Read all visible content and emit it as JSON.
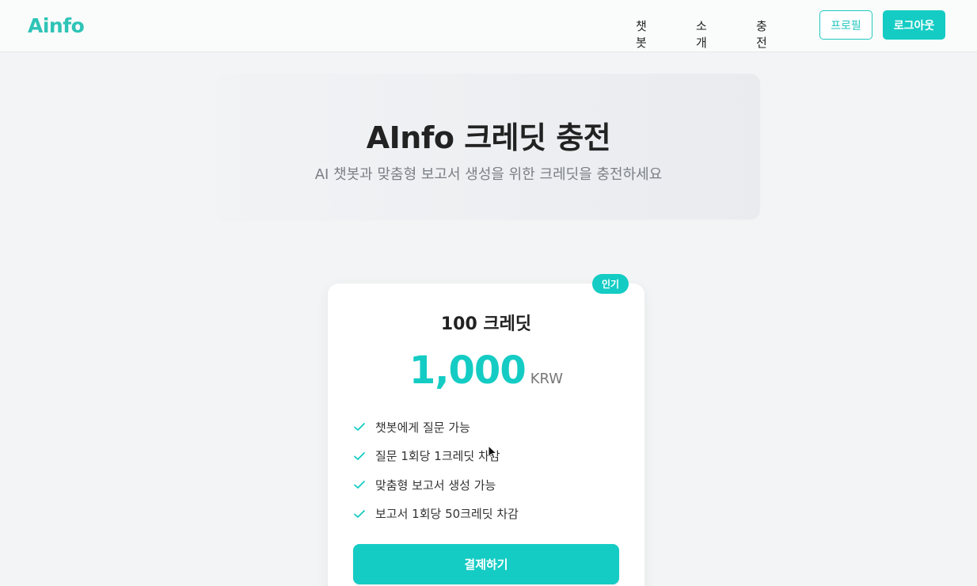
{
  "header": {
    "logo": "Ainfo",
    "nav": [
      "챗봇",
      "소개",
      "충전"
    ],
    "profile_label": "프로필",
    "logout_label": "로그아웃"
  },
  "hero": {
    "title": "AInfo 크레딧 충전",
    "subtitle": "AI 챗봇과 맞춤형 보고서 생성을 위한 크레딧을 충전하세요"
  },
  "plan": {
    "badge": "인기",
    "title": "100 크레딧",
    "price": "1,000",
    "currency": "KRW",
    "features": [
      "챗봇에게 질문 가능",
      "질문 1회당 1크레딧 차감",
      "맞춤형 보고서 생성 가능",
      "보고서 1회당 50크레딧 차감"
    ],
    "pay_label": "결제하기"
  },
  "colors": {
    "accent": "#14ccc4",
    "logo": "#2ec4b6",
    "background": "#f3f4f5"
  },
  "icons": {
    "feature_icon": "check-icon",
    "pointer": "cursor-icon"
  }
}
